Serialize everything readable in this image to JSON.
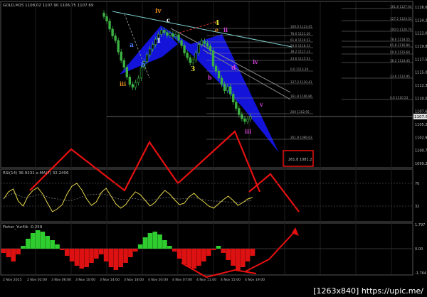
{
  "colors": {
    "background": "#000000",
    "grid": "#1e1e1e",
    "axis_text": "#c0c0c0",
    "candle": "#3cb043",
    "pattern_fill": "#1414e6",
    "rsi_line": "#e8d84a",
    "fisher_pos": "#2ecc2e",
    "fisher_neg": "#dd1111",
    "arrow_red": "#e81010",
    "label_orange": "#e08a1e",
    "label_yellow": "#e8e030",
    "label_blue": "#4a7dff",
    "label_magenta": "#d040d0",
    "label_white": "#ffffff",
    "fib_line": "#8a8a8a",
    "target_box": "#e81010"
  },
  "chart_data": [
    {
      "type": "candlestick",
      "panel": "price",
      "title": "GOLD,M15  1108.02 1107.90 1106.75 1107.69",
      "y_axis_labels": [
        "1126.6",
        "1124.2",
        "1122.0",
        "1119.8",
        "1117.5",
        "1115.0",
        "1112.3",
        "1110.0",
        "1107.6",
        "1105.2",
        "1102.9",
        "1100.7",
        "1099.2"
      ],
      "current_price_label": "1107.69",
      "fib_labels": [
        "100.0 1123.45",
        "78.6 1121.26",
        "61.8 1119.53",
        "50.0 1118.33",
        "38.2 1117.13",
        "23.6 1115.63",
        "0.0 1113.20",
        "127.2 1110.41",
        "161.8 1106.86",
        "200 1102.95",
        "261.8 1096.63"
      ],
      "fib_labels_right": [
        "161.8 1127.04",
        "127.2 1123.52",
        "100.0 1120.74",
        "78.6 1118.55",
        "61.8 1116.84",
        "50.0 1115.64",
        "38.2 1114.43",
        "23.6 1112.95",
        "0.0 1110.53"
      ],
      "wave_labels": [
        "iv",
        "c",
        "4",
        "e",
        "ii",
        "a",
        "1",
        "b",
        "3",
        "d",
        "iv",
        "b",
        "v",
        "iii",
        "iii"
      ],
      "target_box_label": "261.8 1081.2",
      "close_series": [
        1125.2,
        1124.4,
        1123.0,
        1121.8,
        1121.0,
        1119.0,
        1117.5,
        1116.3,
        1114.6,
        1113.3,
        1112.8,
        1113.6,
        1114.4,
        1116.2,
        1117.3,
        1118.5,
        1119.5,
        1120.3,
        1121.2,
        1122.1,
        1122.8,
        1122.4,
        1121.9,
        1122.2,
        1121.7,
        1122.0,
        1121.0,
        1120.1,
        1118.8,
        1118.0,
        1117.1,
        1117.6,
        1118.8,
        1120.3,
        1120.9,
        1120.5,
        1120.0,
        1119.2,
        1116.5,
        1115.6,
        1114.4,
        1113.3,
        1112.2,
        1112.9,
        1111.6,
        1110.2,
        1109.1,
        1108.0,
        1107.3,
        1106.8,
        1107.2,
        1107.69
      ]
    },
    {
      "type": "line",
      "panel": "rsi",
      "title": "RSI(14) 36.9231  x-MA(7) 32.2406",
      "y_axis_labels": [
        "70",
        "32"
      ],
      "values": [
        48,
        58,
        62,
        45,
        38,
        52,
        60,
        64,
        55,
        42,
        30,
        34,
        40,
        55,
        66,
        70,
        61,
        48,
        39,
        44,
        57,
        63,
        52,
        41,
        35,
        40,
        50,
        58,
        54,
        46,
        38,
        43,
        52,
        60,
        55,
        47,
        40,
        42,
        51,
        56,
        49,
        44,
        38,
        35,
        41,
        47,
        52,
        46,
        39,
        43,
        48,
        50
      ]
    },
    {
      "type": "bar",
      "panel": "fisher",
      "title": "Fisher_Yur4ik -0.259",
      "y_axis_labels": [
        "1.797",
        "0.00",
        "-1.764"
      ],
      "values": [
        -0.3,
        -0.6,
        -0.9,
        -0.4,
        0.2,
        0.7,
        1.1,
        1.3,
        1.2,
        0.9,
        0.6,
        0.3,
        -0.1,
        -0.5,
        -0.9,
        -1.2,
        -1.4,
        -1.3,
        -1.0,
        -0.7,
        -0.4,
        -0.9,
        -1.3,
        -1.5,
        -1.3,
        -1.0,
        -0.6,
        -0.2,
        0.3,
        0.8,
        1.1,
        1.2,
        1.0,
        0.6,
        0.2,
        -0.2,
        -0.7,
        -1.1,
        -1.3,
        -1.4,
        -1.2,
        -0.9,
        -0.5,
        -0.1,
        0.2,
        -0.3,
        -0.8,
        -1.2,
        -1.5,
        -1.3,
        -0.9,
        -0.5
      ]
    }
  ],
  "time_axis": [
    "2 Nov 2015",
    "2 Nov 02:00",
    "3 Nov 06:00",
    "3 Nov 10:00",
    "3 Nov 14:00",
    "3 Nov 18:00",
    "4 Nov 03:00",
    "4 Nov 07:00",
    "4 Nov 11:00",
    "4 Nov 15:00",
    "4 Nov 19:00"
  ],
  "watermark": "[1263x840] https://upic.me/"
}
